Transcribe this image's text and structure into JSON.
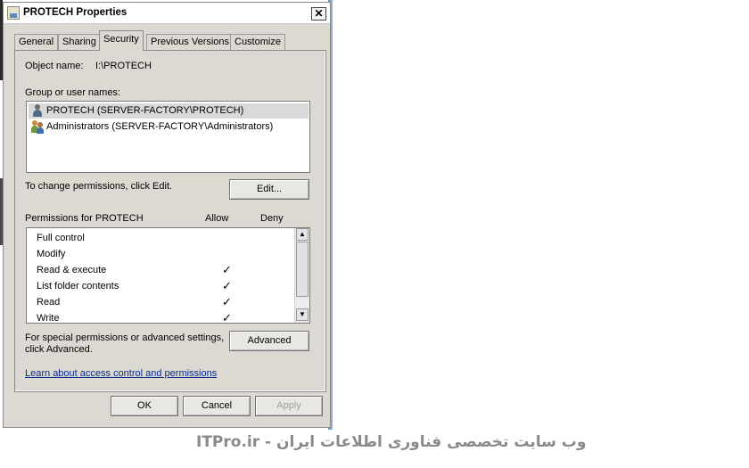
{
  "window": {
    "title": "PROTECH Properties",
    "close_glyph": "✕"
  },
  "tabs": [
    {
      "label": "General"
    },
    {
      "label": "Sharing"
    },
    {
      "label": "Security",
      "active": true
    },
    {
      "label": "Previous Versions"
    },
    {
      "label": "Customize"
    }
  ],
  "security": {
    "object_name_label": "Object name:",
    "object_name_value": "I:\\PROTECH",
    "group_label": "Group or user names:",
    "users": [
      {
        "name": "PROTECH (SERVER-FACTORY\\PROTECH)",
        "icon": "user-icon",
        "selected": true
      },
      {
        "name": "Administrators (SERVER-FACTORY\\Administrators)",
        "icon": "group-icon",
        "selected": false
      }
    ],
    "change_text": "To change permissions, click Edit.",
    "edit_button": "Edit...",
    "permissions_label": "Permissions for PROTECH",
    "allow_header": "Allow",
    "deny_header": "Deny",
    "permissions": [
      {
        "name": "Full control",
        "allow": false,
        "deny": false
      },
      {
        "name": "Modify",
        "allow": false,
        "deny": false
      },
      {
        "name": "Read & execute",
        "allow": true,
        "deny": false
      },
      {
        "name": "List folder contents",
        "allow": true,
        "deny": false
      },
      {
        "name": "Read",
        "allow": true,
        "deny": false
      },
      {
        "name": "Write",
        "allow": true,
        "deny": false
      }
    ],
    "check_glyph": "✓",
    "special_text_line1": "For special permissions or advanced settings,",
    "special_text_line2": "click Advanced.",
    "advanced_button": "Advanced",
    "learn_link": "Learn about access control and permissions"
  },
  "footer": {
    "ok": "OK",
    "cancel": "Cancel",
    "apply": "Apply"
  },
  "watermark": "ITPro.ir - وب سایت تخصصی فناوری اطلاعات ایران",
  "scroll_up_glyph": "▲",
  "scroll_down_glyph": "▼"
}
